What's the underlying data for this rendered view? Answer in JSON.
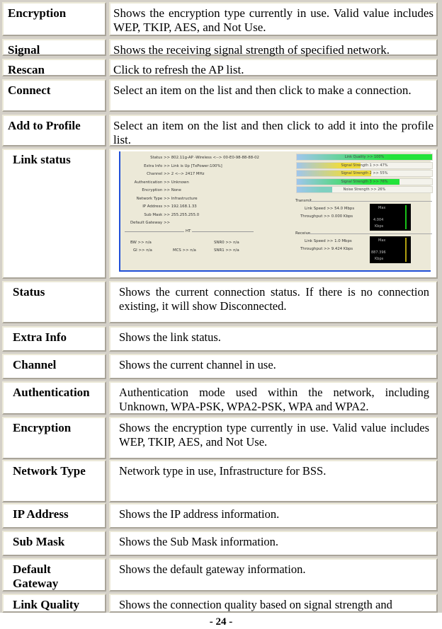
{
  "top_table": [
    {
      "term": "Encryption",
      "description": "Shows the encryption type currently in use. Valid value includes WEP, TKIP, AES, and Not Use."
    },
    {
      "term": "Signal",
      "description": "Shows the receiving signal strength of specified network."
    },
    {
      "term": "Rescan",
      "description": "Click to refresh the AP list."
    },
    {
      "term": "Connect",
      "description": "Select an item on the list and then click to make a connection."
    },
    {
      "term": "Add to Profile",
      "description": "Select an item on the list and then click to add it into the profile list."
    }
  ],
  "link_status": {
    "term": "Link status",
    "screenshot": {
      "fields": [
        {
          "key": "Status >>",
          "value": "802.11g-AP -Wireless  <--> 00-E0-98-88-88-02"
        },
        {
          "key": "Extra Info >>",
          "value": "Link is Up [TxPower:100%]"
        },
        {
          "key": "Channel >>",
          "value": "2 <--> 2417 MHz"
        },
        {
          "key": "Authentication >>",
          "value": "Unknown"
        },
        {
          "key": "Encryption >>",
          "value": "None"
        },
        {
          "key": "Network Type >>",
          "value": "Infrastructure"
        },
        {
          "key": "IP Address >>",
          "value": "192.168.1.33"
        },
        {
          "key": "Sub Mask >>",
          "value": "255.255.255.0"
        },
        {
          "key": "Default Gateway >>",
          "value": ""
        }
      ],
      "ht_label": "HT",
      "ht_fields": {
        "bw": "BW >> n/a",
        "gi": "GI >> n/a",
        "mcs": "MCS >> n/a",
        "snr0": "SNR0 >> n/a",
        "snr1": "SNR1 >> n/a"
      },
      "bars": [
        {
          "label": "Link Quality >> 100%",
          "percent": 100,
          "color": "#22e33a"
        },
        {
          "label": "Signal Strength 1 >> 47%",
          "percent": 47,
          "color": "#f0dc3c"
        },
        {
          "label": "Signal Strength 2 >> 55%",
          "percent": 55,
          "color": "#f0dc3c"
        },
        {
          "label": "Signal Strength 3 >> 76%",
          "percent": 76,
          "color": "#22e33a"
        },
        {
          "label": "Noise Strength >> 26%",
          "percent": 26,
          "color": "#7fd0c0"
        }
      ],
      "transmit": {
        "title": "Transmit",
        "link_speed": "Link Speed >> 54.0 Mbps",
        "throughput": "Throughput >> 0.000 Kbps",
        "graph_max": "Max",
        "graph_value": "4.004",
        "graph_unit": "Kbps",
        "graph_color": "#18c018"
      },
      "receive": {
        "title": "Receive",
        "link_speed": "Link Speed >> 1.0 Mbps",
        "throughput": "Throughput >> 9.424 Kbps",
        "graph_max": "Max",
        "graph_value": "887.396",
        "graph_unit": "Kbps",
        "graph_color": "#b0a010"
      }
    }
  },
  "bottom_table": [
    {
      "term": "Status",
      "description": "Shows the current connection status. If there is no connection existing, it will show Disconnected."
    },
    {
      "term": "Extra Info",
      "description": "Shows the link status."
    },
    {
      "term": "Channel",
      "description": "Shows the current channel in use."
    },
    {
      "term": "Authentication",
      "description": "Authentication mode used within the network, including Unknown, WPA-PSK, WPA2-PSK, WPA and WPA2."
    },
    {
      "term": "Encryption",
      "description": "Shows the encryption type currently in use. Valid value includes WEP, TKIP, AES, and Not Use."
    },
    {
      "term": "Network Type",
      "description": "Network type in use, Infrastructure for BSS."
    },
    {
      "term": "IP Address",
      "description": "Shows the IP address information."
    },
    {
      "term": "Sub Mask",
      "description": "Shows the Sub Mask information."
    },
    {
      "term": "Default Gateway",
      "description": "Shows the default gateway information."
    },
    {
      "term": "Link Quality",
      "description": "Shows the connection quality based on signal strength and"
    }
  ],
  "footer": {
    "page_number": "- 24 -"
  }
}
